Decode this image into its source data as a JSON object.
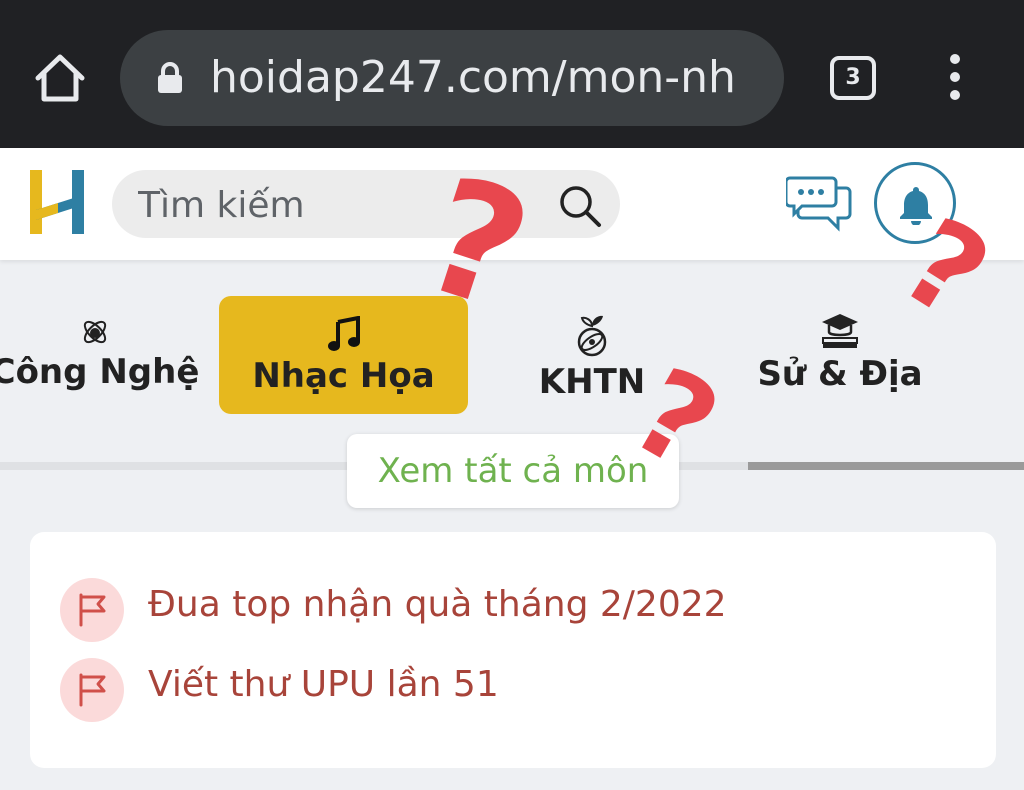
{
  "browser": {
    "url": "hoidap247.com/mon-nh",
    "tab_count": "3",
    "icons": [
      "home-icon",
      "lock-icon",
      "tab-switcher-icon",
      "more-vert-icon"
    ]
  },
  "header": {
    "search_placeholder": "Tìm kiếm",
    "icons": [
      "logo",
      "search-icon",
      "chat-icon",
      "bell-icon"
    ],
    "colors": {
      "accent": "#2e7fa3",
      "logo_yellow": "#e6b81e",
      "logo_blue": "#2e7fa3"
    }
  },
  "subjects": {
    "items": [
      {
        "label": "Công Nghệ",
        "icon": "atom-icon",
        "active": false
      },
      {
        "label": "Nhạc Họa",
        "icon": "music-note-icon",
        "active": true
      },
      {
        "label": "KHTN",
        "icon": "science-icon",
        "active": false
      },
      {
        "label": "Sử & Địa",
        "icon": "graduation-books-icon",
        "active": false
      }
    ],
    "see_all": "Xem tất cả môn",
    "active_color": "#e6b81e",
    "see_all_color": "#6fb24f"
  },
  "announcements": {
    "items": [
      {
        "text": "Đua top nhận quà tháng 2/2022",
        "icon": "flag-icon"
      },
      {
        "text": "Viết thư UPU lần 51",
        "icon": "flag-icon"
      }
    ],
    "text_color": "#a8443a"
  },
  "overlay": {
    "marks": [
      "?",
      "?",
      "?"
    ],
    "color": "#e8474e"
  }
}
